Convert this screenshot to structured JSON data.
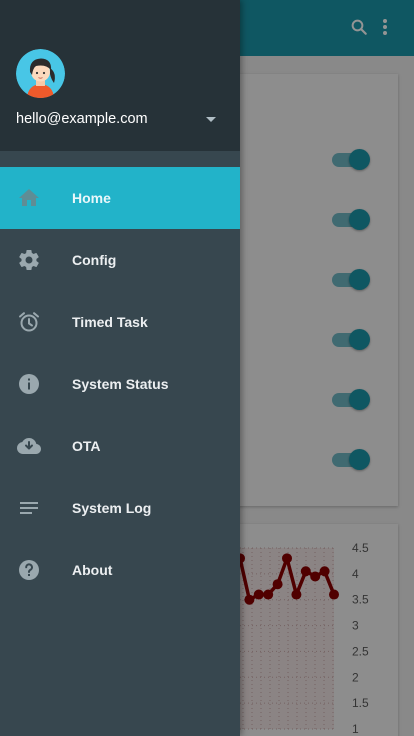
{
  "appbar": {
    "color": "#1a97a9",
    "icons": [
      "search-icon",
      "more-vert-icon"
    ]
  },
  "toggles": [
    {
      "name": "toggle-1",
      "on": true
    },
    {
      "name": "toggle-2",
      "on": true
    },
    {
      "name": "toggle-3",
      "on": true
    },
    {
      "name": "toggle-4",
      "on": true
    },
    {
      "name": "toggle-5",
      "on": true
    },
    {
      "name": "toggle-6",
      "on": true
    }
  ],
  "chart_data": {
    "type": "line",
    "title": "",
    "xlabel": "",
    "ylabel": "",
    "ylim": [
      1,
      4.5
    ],
    "y_ticks": [
      "4.5",
      "4",
      "3.5",
      "3",
      "2.5",
      "2",
      "1.5",
      "1"
    ],
    "grid": true,
    "series": [
      {
        "color": "#8b0000",
        "values": [
          4.3,
          3.5,
          3.6,
          3.6,
          3.8,
          4.3,
          3.6,
          4.05,
          3.95,
          4.05,
          3.6
        ]
      }
    ]
  },
  "drawer": {
    "account_email": "hello@example.com",
    "avatar_icon": "avatar-girl",
    "items": [
      {
        "label": "Home",
        "icon": "home-icon",
        "active": true
      },
      {
        "label": "Config",
        "icon": "gear-icon",
        "active": false
      },
      {
        "label": "Timed Task",
        "icon": "alarm-icon",
        "active": false
      },
      {
        "label": "System Status",
        "icon": "info-icon",
        "active": false
      },
      {
        "label": "OTA",
        "icon": "cloud-download-icon",
        "active": false
      },
      {
        "label": "System Log",
        "icon": "notes-icon",
        "active": false
      },
      {
        "label": "About",
        "icon": "help-icon",
        "active": false
      }
    ],
    "colors": {
      "header": "#263238",
      "body": "#37474f",
      "active": "#22b3c9"
    }
  }
}
